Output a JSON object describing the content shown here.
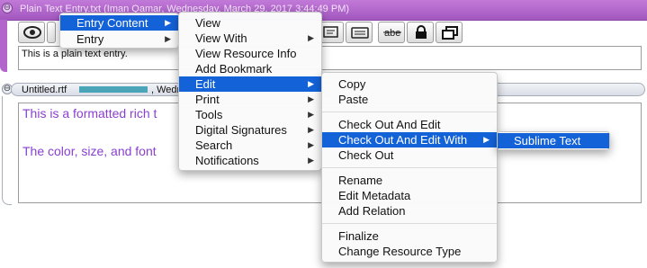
{
  "entry1": {
    "title": "Plain Text Entry.txt (Iman Qamar, Wednesday, March 29, 2017 3:44:49 PM)",
    "content": "This is a plain text entry.",
    "toolbar_icons": [
      "eye-icon",
      "chat-icon",
      "card-icon",
      "abe-strike-icon",
      "lock-icon",
      "windows-icon"
    ],
    "toolbar_strike_label": "abe"
  },
  "entry2": {
    "title_prefix": "Untitled.rtf",
    "title_suffix": ", Wedn",
    "content_line1": "This is a formatted rich t",
    "content_line2": "The color, size, and font"
  },
  "menus": {
    "entry_menu": [
      "Entry Content",
      "Entry"
    ],
    "content_menu": [
      "View",
      "View With",
      "View Resource Info",
      "Add Bookmark",
      "Edit",
      "Print",
      "Tools",
      "Digital Signatures",
      "Search",
      "Notifications"
    ],
    "edit_menu": {
      "group1": [
        "Copy",
        "Paste"
      ],
      "group2": [
        "Check Out And Edit",
        "Check Out And Edit With",
        "Check Out"
      ],
      "group3": [
        "Rename",
        "Edit Metadata",
        "Add Relation"
      ],
      "group4": [
        "Finalize",
        "Change Resource Type"
      ]
    },
    "with_menu": [
      "Sublime Text"
    ]
  },
  "colors": {
    "entry_title_purple": "#a257be",
    "menu_highlight": "#1462d8",
    "rich_text_purple": "#8a3fd1"
  }
}
